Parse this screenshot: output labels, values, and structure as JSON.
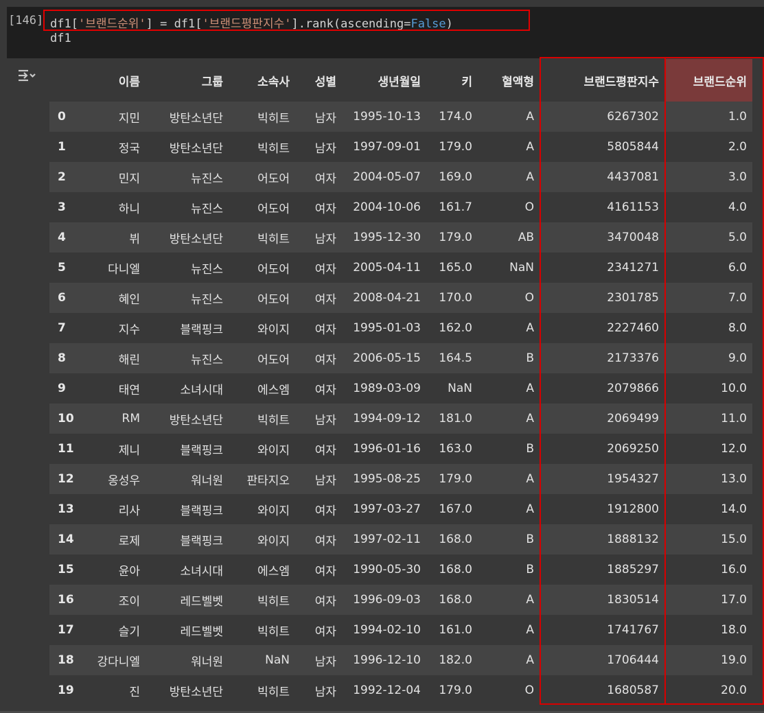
{
  "code_cell": {
    "exec_count": "[146]",
    "line1_prefix": "df1[",
    "line1_str1": "'브랜드순위'",
    "line1_mid": "] = df1[",
    "line1_str2": "'브랜드평판지수'",
    "line1_call": "].rank(ascending=",
    "line1_kw": "False",
    "line1_end": ")",
    "line2": "df1"
  },
  "table": {
    "columns": [
      "",
      "이름",
      "그룹",
      "소속사",
      "성별",
      "생년월일",
      "키",
      "혈액형",
      "브랜드평판지수",
      "브랜드순위"
    ],
    "rows": [
      [
        "0",
        "지민",
        "방탄소년단",
        "빅히트",
        "남자",
        "1995-10-13",
        "174.0",
        "A",
        "6267302",
        "1.0"
      ],
      [
        "1",
        "정국",
        "방탄소년단",
        "빅히트",
        "남자",
        "1997-09-01",
        "179.0",
        "A",
        "5805844",
        "2.0"
      ],
      [
        "2",
        "민지",
        "뉴진스",
        "어도어",
        "여자",
        "2004-05-07",
        "169.0",
        "A",
        "4437081",
        "3.0"
      ],
      [
        "3",
        "하니",
        "뉴진스",
        "어도어",
        "여자",
        "2004-10-06",
        "161.7",
        "O",
        "4161153",
        "4.0"
      ],
      [
        "4",
        "뷔",
        "방탄소년단",
        "빅히트",
        "남자",
        "1995-12-30",
        "179.0",
        "AB",
        "3470048",
        "5.0"
      ],
      [
        "5",
        "다니엘",
        "뉴진스",
        "어도어",
        "여자",
        "2005-04-11",
        "165.0",
        "NaN",
        "2341271",
        "6.0"
      ],
      [
        "6",
        "혜인",
        "뉴진스",
        "어도어",
        "여자",
        "2008-04-21",
        "170.0",
        "O",
        "2301785",
        "7.0"
      ],
      [
        "7",
        "지수",
        "블랙핑크",
        "와이지",
        "여자",
        "1995-01-03",
        "162.0",
        "A",
        "2227460",
        "8.0"
      ],
      [
        "8",
        "해린",
        "뉴진스",
        "어도어",
        "여자",
        "2006-05-15",
        "164.5",
        "B",
        "2173376",
        "9.0"
      ],
      [
        "9",
        "태연",
        "소녀시대",
        "에스엠",
        "여자",
        "1989-03-09",
        "NaN",
        "A",
        "2079866",
        "10.0"
      ],
      [
        "10",
        "RM",
        "방탄소년단",
        "빅히트",
        "남자",
        "1994-09-12",
        "181.0",
        "A",
        "2069499",
        "11.0"
      ],
      [
        "11",
        "제니",
        "블랙핑크",
        "와이지",
        "여자",
        "1996-01-16",
        "163.0",
        "B",
        "2069250",
        "12.0"
      ],
      [
        "12",
        "옹성우",
        "워너원",
        "판타지오",
        "남자",
        "1995-08-25",
        "179.0",
        "A",
        "1954327",
        "13.0"
      ],
      [
        "13",
        "리사",
        "블랙핑크",
        "와이지",
        "여자",
        "1997-03-27",
        "167.0",
        "A",
        "1912800",
        "14.0"
      ],
      [
        "14",
        "로제",
        "블랙핑크",
        "와이지",
        "여자",
        "1997-02-11",
        "168.0",
        "B",
        "1888132",
        "15.0"
      ],
      [
        "15",
        "윤아",
        "소녀시대",
        "에스엠",
        "여자",
        "1990-05-30",
        "168.0",
        "B",
        "1885297",
        "16.0"
      ],
      [
        "16",
        "조이",
        "레드벨벳",
        "빅히트",
        "여자",
        "1996-09-03",
        "168.0",
        "A",
        "1830514",
        "17.0"
      ],
      [
        "17",
        "슬기",
        "레드벨벳",
        "빅히트",
        "여자",
        "1994-02-10",
        "161.0",
        "A",
        "1741767",
        "18.0"
      ],
      [
        "18",
        "강다니엘",
        "워너원",
        "NaN",
        "남자",
        "1996-12-10",
        "182.0",
        "A",
        "1706444",
        "19.0"
      ],
      [
        "19",
        "진",
        "방탄소년단",
        "빅히트",
        "남자",
        "1992-12-04",
        "179.0",
        "O",
        "1680587",
        "20.0"
      ]
    ]
  },
  "icons": {
    "output_toggle": "output-toggle-icon"
  },
  "colors": {
    "highlight": "#d80000",
    "string": "#ce9178",
    "keyword": "#569cd6"
  }
}
